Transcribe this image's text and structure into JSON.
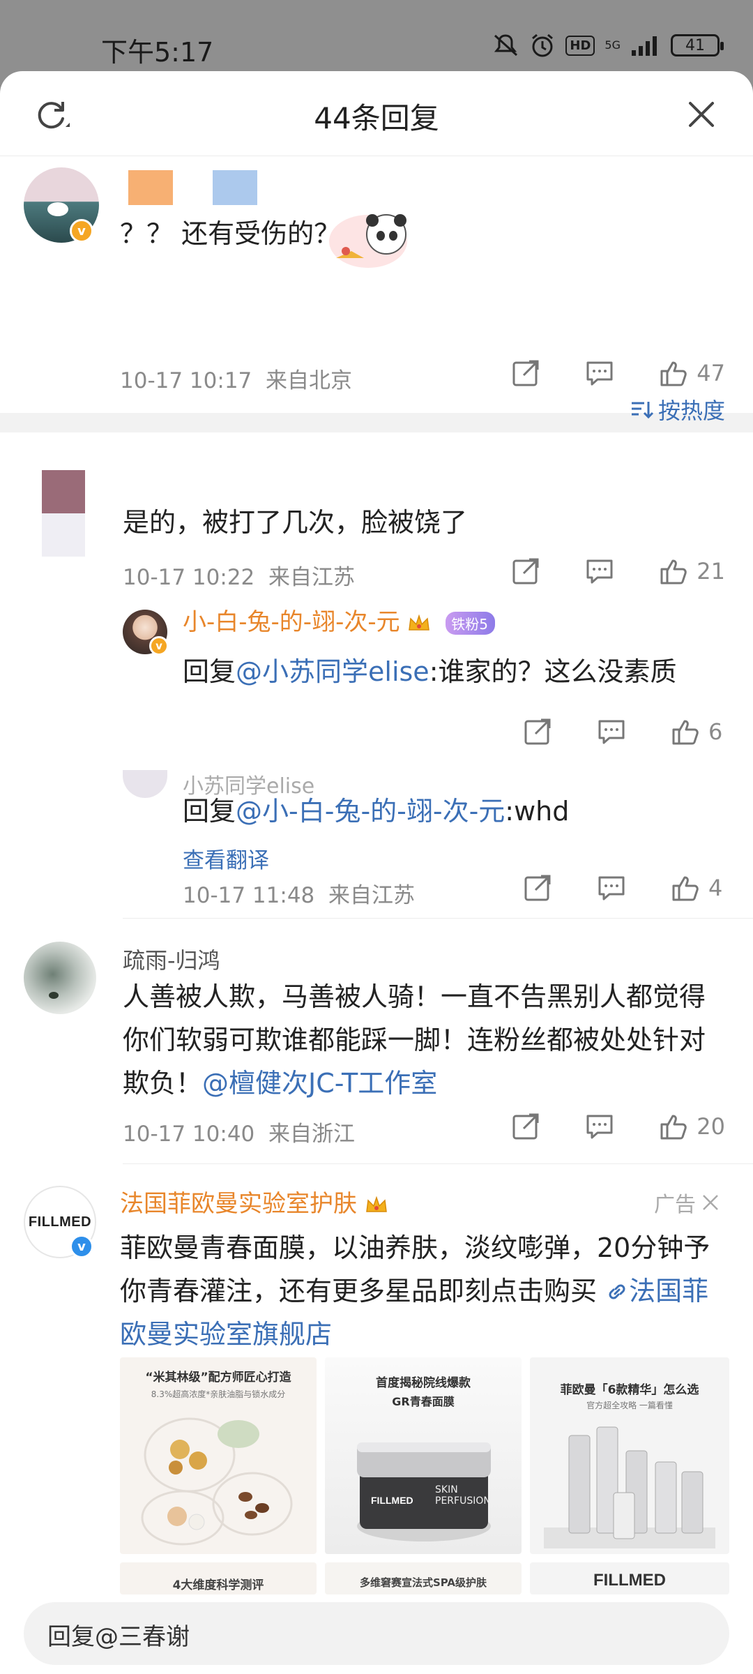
{
  "status": {
    "time": "下午5:17",
    "battery": "41",
    "network": "5G"
  },
  "sheet": {
    "title": "44条回复"
  },
  "top_comment": {
    "text": "？？ 还有受伤的？",
    "time": "10-17 10:17",
    "location": "来自北京",
    "likes": "47"
  },
  "sort": {
    "label": "按热度"
  },
  "comments": [
    {
      "text": "是的，被打了几次，脸被饶了",
      "time": "10-17 10:22",
      "location": "来自江苏",
      "likes": "21",
      "replies": [
        {
          "username": "小-白-兔-的-翊-次-元",
          "fan_badge": "铁粉5",
          "prefix": "回复",
          "mention": "@小苏同学elise",
          "body": ":谁家的？这么没素质",
          "likes": "6"
        },
        {
          "username": "小苏同学elise",
          "prefix": "回复",
          "mention": "@小-白-兔-的-翊-次-元",
          "body": ":whd",
          "translate": "查看翻译",
          "time": "10-17 11:48",
          "location": "来自江苏",
          "likes": "4"
        }
      ]
    },
    {
      "username": "疏雨-归鸿",
      "text": "人善被人欺，马善被人骑！一直不告黑别人都觉得你们软弱可欺谁都能踩一脚！连粉丝都被处处针对欺负！",
      "mention": "@檀健次JC-T工作室",
      "time": "10-17 10:40",
      "location": "来自浙江",
      "likes": "20"
    }
  ],
  "ad": {
    "brand": "法国菲欧曼实验室护肤",
    "tag": "广告",
    "avatar_text": "FILLMED",
    "text": "菲欧曼青春面膜，以油养肤，淡纹嘭弹，20分钟予你青春灌注，还有更多星品即刻点击购买",
    "link": "法国菲欧曼实验室旗舰店",
    "images": [
      {
        "caption": "“米其林级”配方师匠心打造",
        "sub": "8.3%超高浓度*亲肤油脂与锁水成分"
      },
      {
        "caption": "首度揭秘院线爆款",
        "sub": "GR青春面膜",
        "product": "SKIN PERFUSION"
      },
      {
        "caption": "菲欧曼「6款精华」怎么选",
        "sub": "官方超全攻略 一篇看懂"
      }
    ],
    "images_row2": [
      "4大维度科学测评",
      "多维窘赛宣法式SPA级护肤",
      "FILLMED"
    ]
  },
  "reply_box": {
    "placeholder": "回复@三春谢"
  }
}
